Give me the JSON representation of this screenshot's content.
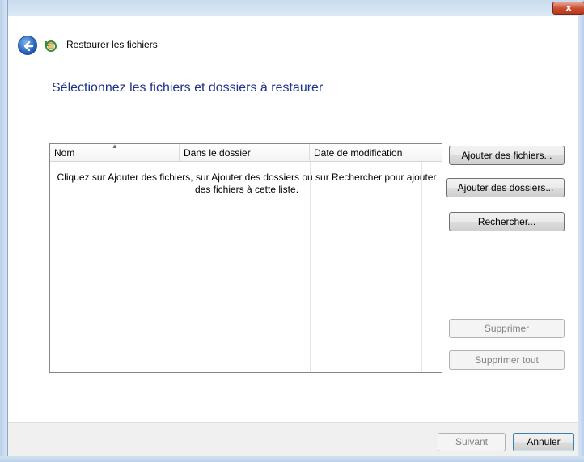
{
  "window": {
    "title": "Restaurer les fichiers",
    "close_label": "x"
  },
  "main": {
    "heading": "Sélectionnez les fichiers et dossiers à restaurer"
  },
  "list": {
    "columns": [
      "Nom",
      "Dans le dossier",
      "Date de modification",
      ""
    ],
    "sort_column": "Nom",
    "empty_message": "Cliquez sur Ajouter des fichiers, sur Ajouter des dossiers ou sur Rechercher pour ajouter des fichiers à cette liste."
  },
  "side_buttons": {
    "add_files": "Ajouter des fichiers...",
    "add_folders": "Ajouter des dossiers...",
    "search": "Rechercher...",
    "remove": "Supprimer",
    "remove_all": "Supprimer tout"
  },
  "footer": {
    "next": "Suivant",
    "cancel": "Annuler"
  },
  "icons": {
    "back": "back-arrow-icon",
    "app": "restore-files-icon",
    "close": "close-icon",
    "sort": "sort-ascending-icon"
  },
  "colors": {
    "heading": "#1e3287",
    "close_button": "#c84a2c",
    "back_button": "#1e5fb8"
  }
}
